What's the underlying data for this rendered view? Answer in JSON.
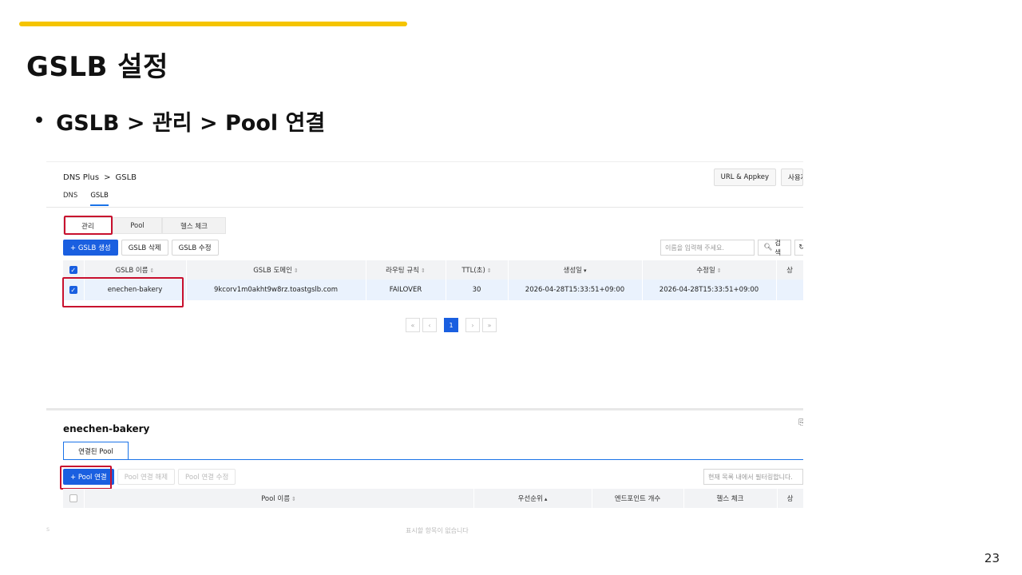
{
  "slide": {
    "title": "GSLB 설정",
    "bullet": "GSLB > 관리 > Pool 연결",
    "page_number": "23",
    "accent_color": "#f5c400"
  },
  "console": {
    "breadcrumb": {
      "root": "DNS Plus",
      "separator": ">",
      "current": "GSLB"
    },
    "top_buttons": {
      "appkey": "URL & Appkey",
      "cut_label": "사용자"
    },
    "sub_tabs": [
      "DNS",
      "GSLB"
    ],
    "main_tabs": [
      "관리",
      "Pool",
      "헬스 체크"
    ],
    "actions": {
      "create": "+ GSLB 생성",
      "delete": "GSLB 삭제",
      "edit": "GSLB 수정"
    },
    "search": {
      "placeholder": "이름을 입력해 주세요.",
      "button": "검색"
    },
    "table": {
      "headers": [
        "GSLB 이름",
        "GSLB 도메인",
        "라우팅 규칙",
        "TTL(초)",
        "생성일",
        "수정일",
        "상"
      ],
      "rows": [
        {
          "name": "enechen-bakery",
          "domain": "9kcorv1m0akht9w8rz.toastgslb.com",
          "routing": "FAILOVER",
          "ttl": "30",
          "created": "2026-04-28T15:33:51+09:00",
          "modified": "2026-04-28T15:33:51+09:00"
        }
      ]
    },
    "pagination": {
      "first": "«",
      "prev": "‹",
      "current": "1",
      "next": "›",
      "last": "»"
    },
    "detail": {
      "title": "enechen-bakery",
      "tab": "연결된 Pool",
      "actions": {
        "connect": "+ Pool 연결",
        "disconnect": "Pool 연결 해제",
        "edit": "Pool 연결 수정"
      },
      "filter_placeholder": "현재 목록 내에서 필터링합니다.",
      "headers": [
        "Pool 이름",
        "우선순위",
        "엔드포인트 개수",
        "헬스 체크",
        "상"
      ],
      "empty_text": "표시할 항목이 없습니다",
      "right_glyph": "⎘",
      "left_glyph": "s"
    }
  }
}
